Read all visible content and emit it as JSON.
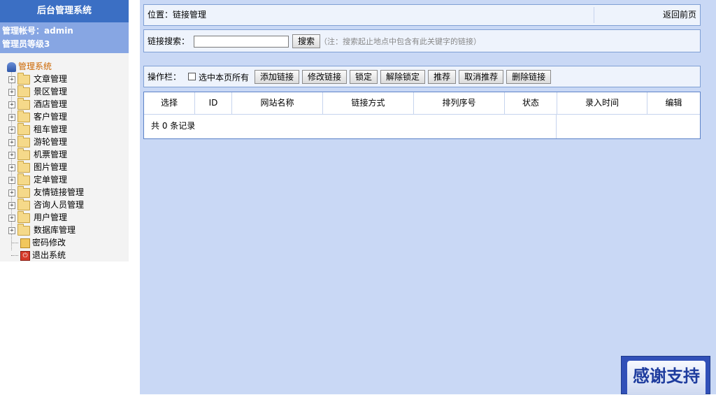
{
  "sidebar": {
    "title": "后台管理系统",
    "account": "管理帐号：admin",
    "level": "管理员等级3",
    "root": "管理系统",
    "folders": [
      "文章管理",
      "景区管理",
      "酒店管理",
      "客户管理",
      "租车管理",
      "游轮管理",
      "机票管理",
      "图片管理",
      "定单管理",
      "友情链接管理",
      "咨询人员管理",
      "用户管理",
      "数据库管理"
    ],
    "password": "密码修改",
    "logout": "退出系统"
  },
  "location": {
    "text": "位置：链接管理",
    "back": "返回前页"
  },
  "search": {
    "label": "链接搜索：",
    "value": "",
    "button": "搜索",
    "note": "（注：搜索起止地点中包含有此关键字的链接）"
  },
  "ops": {
    "label": "操作栏：",
    "select_all": "选中本页所有",
    "buttons": [
      "添加链接",
      "修改链接",
      "锁定",
      "解除锁定",
      "推荐",
      "取消推荐",
      "删除链接"
    ]
  },
  "table": {
    "headers": [
      "选择",
      "ID",
      "网站名称",
      "链接方式",
      "排列序号",
      "状态",
      "录入时间",
      "编辑"
    ],
    "footer": "共 0 条记录"
  },
  "badge": "感谢支持"
}
